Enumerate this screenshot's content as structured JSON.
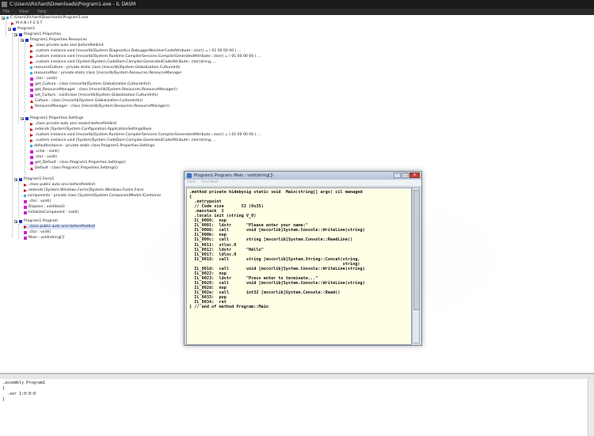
{
  "window": {
    "title": "C:\\Users\\Richard\\Downloads\\Program1.exe - IL DASM"
  },
  "menu": [
    "File",
    "View",
    "Help"
  ],
  "tree": {
    "root": "C:\\Users\\Richard\\Downloads\\Program1.exe",
    "manifest": "M A N I F E S T",
    "ns": "Program1",
    "res_class": "Program1.Properties",
    "resources": "Program1.Properties.Resources",
    "res_items": [
      ".class private auto ansi beforefieldinit",
      ".custom instance void [mscorlib]System.Diagnostics.DebuggerNonUserCodeAttribute::.ctor() = ( 01 00 00 00 )  ...",
      ".custom instance void [mscorlib]System.Runtime.CompilerServices.CompilerGeneratedAttribute::.ctor() = ( 01 00 00 00 )  ...",
      ".custom instance void [System]System.CodeDom.Compiler.GeneratedCodeAttribute::.ctor(string,  ...",
      "resourceCulture : private static class [mscorlib]System.Globalization.CultureInfo",
      "resourceMan : private static class [mscorlib]System.Resources.ResourceManager",
      ".ctor : void()",
      "get_Culture : class [mscorlib]System.Globalization.CultureInfo()",
      "get_ResourceManager : class [mscorlib]System.Resources.ResourceManager()",
      "set_Culture : void(class [mscorlib]System.Globalization.CultureInfo)",
      "Culture : class [mscorlib]System.Globalization.CultureInfo()",
      "ResourceManager : class [mscorlib]System.Resources.ResourceManager()"
    ],
    "settings": "Program1.Properties.Settings",
    "set_items": [
      ".class private auto ansi sealed beforefieldinit",
      "extends [System]System.Configuration.ApplicationSettingsBase",
      ".custom instance void [mscorlib]System.Runtime.CompilerServices.CompilerGeneratedAttribute::.ctor() = ( 01 00 00 00 )  ...",
      ".custom instance void [System]System.CodeDom.Compiler.GeneratedCodeAttribute::.ctor(string,  ...",
      "defaultInstance : private static class Program1.Properties.Settings",
      ".cctor : void()",
      ".ctor : void()",
      "get_Default : class Program1.Properties.Settings()",
      "Default : class Program1.Properties.Settings()"
    ],
    "form1": "Program1.Form1",
    "form_items": [
      ".class public auto ansi beforefieldinit",
      "extends [System.Windows.Forms]System.Windows.Forms.Form",
      "components : private class [System]System.ComponentModel.IContainer",
      ".ctor : void()",
      "Dispose : void(bool)",
      "InitializeComponent : void()"
    ],
    "program": "Program1.Program",
    "prog_items": [
      ".class public auto ansi beforefieldinit",
      ".ctor : void()",
      "Main : void(string[])"
    ]
  },
  "bottom_panel": {
    "text": ".assembly Program1\n{\n  .ver 1:0:0:0\n}"
  },
  "ilwin": {
    "title": "Program1.Program::Main : void(string[])",
    "menu": [
      "Find",
      "Find Next"
    ],
    "code": ".method private hidebysig static void  Main(string[] args) cil managed\n{\n  .entrypoint\n  // Code size       53 (0x35)\n  .maxstack  2\n  .locals init (string V_0)\n  IL_0000:  nop\n  IL_0001:  ldstr      \"Please enter your name:\"\n  IL_0006:  call       void [mscorlib]System.Console::WriteLine(string)\n  IL_000b:  nop\n  IL_000c:  call       string [mscorlib]System.Console::ReadLine()\n  IL_0011:  stloc.0\n  IL_0012:  ldstr      \"Hello\"\n  IL_0017:  ldloc.0\n  IL_0018:  call       string [mscorlib]System.String::Concat(string,\n                                                              string)\n  IL_001d:  call       void [mscorlib]System.Console::WriteLine(string)\n  IL_0022:  nop\n  IL_0023:  ldstr      \"Press enter to terminate...\"\n  IL_0028:  call       void [mscorlib]System.Console::WriteLine(string)\n  IL_002d:  nop\n  IL_002e:  call       int32 [mscorlib]System.Console::Read()\n  IL_0033:  pop\n  IL_0034:  ret\n} // end of method Program::Main"
  }
}
